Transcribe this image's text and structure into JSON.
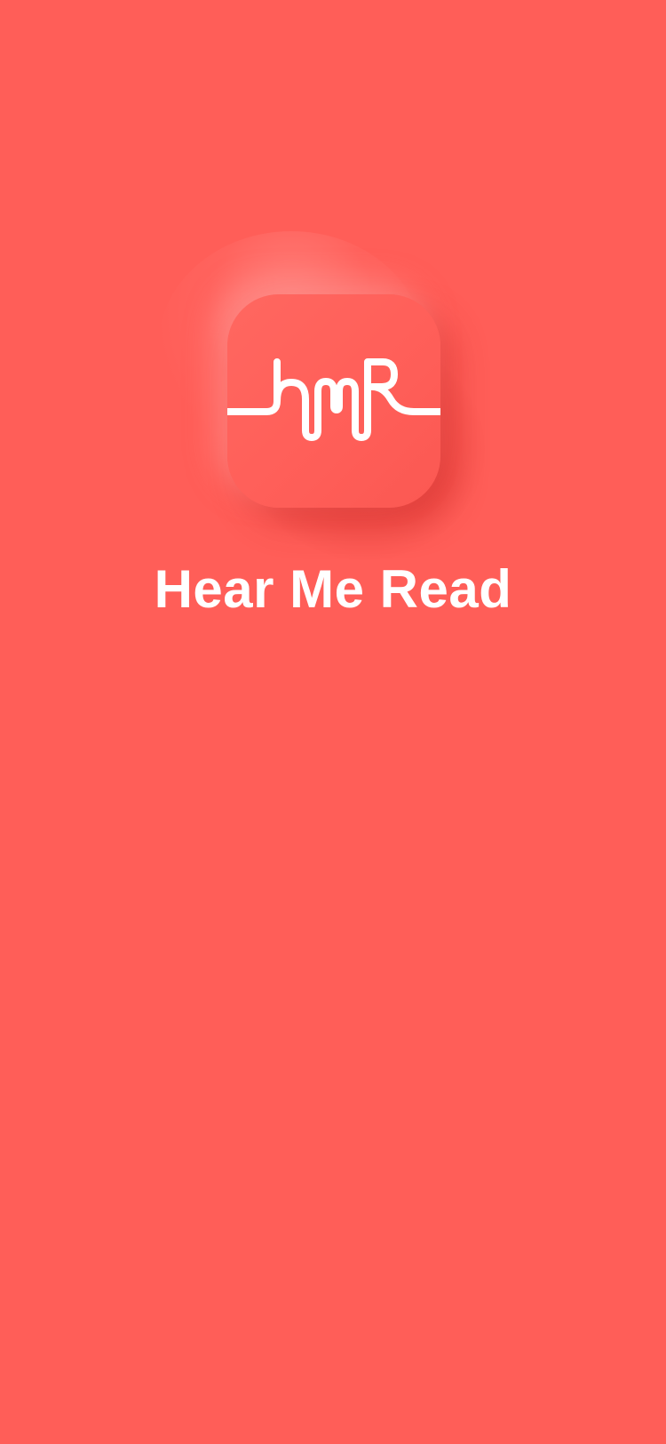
{
  "app": {
    "title": "Hear Me Read"
  },
  "logo": {
    "icon": "hmr-waveform-logo-icon",
    "monogram": "hmr",
    "background_color": "#FF5E58",
    "stroke_color": "#FFFFFF"
  },
  "theme": {
    "background": "#FF5E58",
    "text_color": "#FFFFFF"
  }
}
